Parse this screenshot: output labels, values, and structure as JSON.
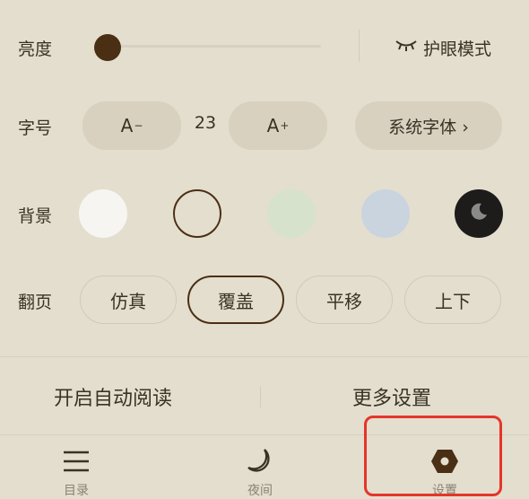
{
  "brightness": {
    "label": "亮度",
    "level": 0.0,
    "eye_care_label": "护眼模式"
  },
  "font": {
    "label": "字号",
    "decrease_label": "A",
    "decrease_sup": "−",
    "value": "23",
    "increase_label": "A",
    "increase_sup": "+",
    "system_font_label": "系统字体 ›"
  },
  "background": {
    "label": "背景",
    "options": [
      {
        "name": "white",
        "color": "#f6f5f2"
      },
      {
        "name": "beige",
        "color": "#e4dece",
        "selected": true
      },
      {
        "name": "green",
        "color": "#d6e2cc"
      },
      {
        "name": "blue",
        "color": "#c9d4df"
      },
      {
        "name": "night",
        "color": "#1d1c1b"
      }
    ]
  },
  "page_turn": {
    "label": "翻页",
    "options": [
      "仿真",
      "覆盖",
      "平移",
      "上下"
    ],
    "selected": "覆盖"
  },
  "actions": {
    "auto_read": "开启自动阅读",
    "more_settings": "更多设置"
  },
  "nav": {
    "toc": "目录",
    "night": "夜间",
    "settings": "设置"
  },
  "colors": {
    "accent": "#4a2f14",
    "background": "#e4dece",
    "highlight": "#e5352a"
  }
}
